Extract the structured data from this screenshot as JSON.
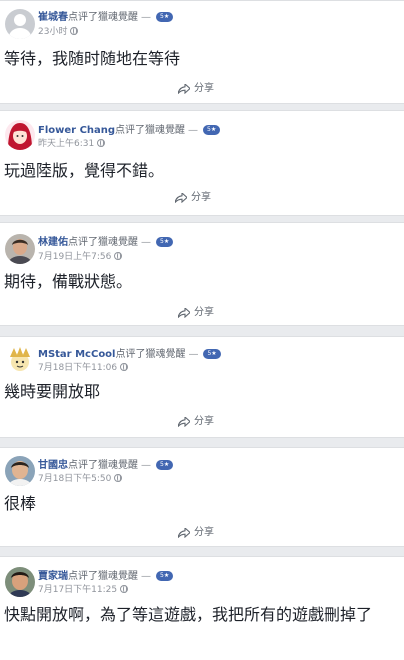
{
  "posts": [
    {
      "author": "崔城春",
      "action": "点评了",
      "page": "獵魂覺醒",
      "dash": "—",
      "badge": "5★",
      "time": "23小时",
      "text": "等待，我随时随地在等待",
      "share": "分享",
      "avatar": "default-avatar"
    },
    {
      "author": "Flower Chang",
      "action": "点评了",
      "page": "獵魂覺醒",
      "dash": "—",
      "badge": "5★",
      "time": "昨天上午6:31",
      "text": "玩過陸版，覺得不錯。",
      "share": "分享",
      "avatar": "anime-girl-avatar"
    },
    {
      "author": "林建佑",
      "action": "点评了",
      "page": "獵魂覺醒",
      "dash": "—",
      "badge": "5★",
      "time": "7月19日上午7:56",
      "text": "期待，備戰狀態。",
      "share": "分享",
      "avatar": "man-photo-avatar"
    },
    {
      "author": "MStar McCool",
      "action": "点评了",
      "page": "獵魂覺醒",
      "dash": "—",
      "badge": "5★",
      "time": "7月18日下午11:06",
      "text": "幾時要開放耶",
      "share": "分享",
      "avatar": "cartoon-avatar"
    },
    {
      "author": "甘國忠",
      "action": "点评了",
      "page": "獵魂覺醒",
      "dash": "—",
      "badge": "5★",
      "time": "7月18日下午5:50",
      "text": "很棒",
      "share": "分享",
      "avatar": "man-photo-avatar"
    },
    {
      "author": "賈家瑞",
      "action": "点评了",
      "page": "獵魂覺醒",
      "dash": "—",
      "badge": "5★",
      "time": "7月17日下午11:25",
      "text": "快點開放啊，為了等這遊戲，我把所有的遊戲刪掉了",
      "share": "",
      "avatar": "man-photo-avatar"
    }
  ],
  "colors": {
    "link": "#365899",
    "badge": "#4267b2",
    "background": "#e9ebee"
  }
}
